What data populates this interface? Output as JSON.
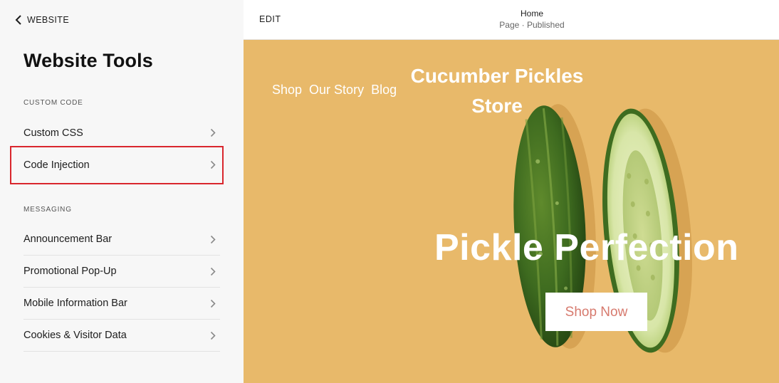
{
  "sidebar": {
    "back_label": "WEBSITE",
    "title": "Website Tools",
    "sections": [
      {
        "label": "CUSTOM CODE",
        "items": [
          {
            "label": "Custom CSS"
          },
          {
            "label": "Code Injection"
          }
        ]
      },
      {
        "label": "MESSAGING",
        "items": [
          {
            "label": "Announcement Bar"
          },
          {
            "label": "Promotional Pop-Up"
          },
          {
            "label": "Mobile Information Bar"
          },
          {
            "label": "Cookies & Visitor Data"
          }
        ]
      }
    ],
    "highlighted_item": "Code Injection"
  },
  "editor": {
    "edit_label": "EDIT",
    "page_name": "Home",
    "page_status": "Page · Published"
  },
  "site": {
    "nav": [
      "Shop",
      "Our Story",
      "Blog"
    ],
    "title": "Cucumber Pickles Store",
    "hero_heading": "Pickle Perfection",
    "cta_label": "Shop Now"
  },
  "colors": {
    "highlight_border": "#d9262d",
    "hero_background": "#e8b96a",
    "cta_text": "#d77a6e",
    "sidebar_background": "#f7f7f7"
  },
  "icons": {
    "back": "chevron-left-icon",
    "item_arrow": "chevron-right-icon"
  }
}
